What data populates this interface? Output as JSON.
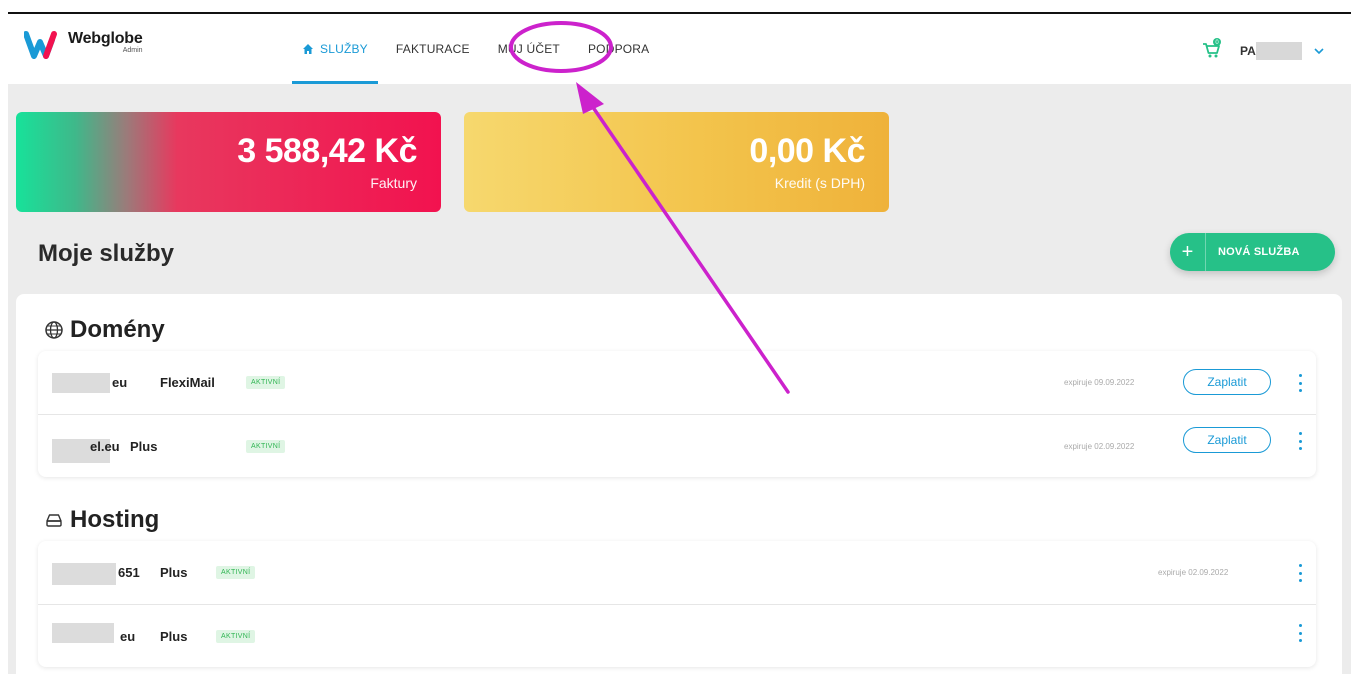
{
  "brand": {
    "name": "Webglobe",
    "sub": "Admin"
  },
  "nav": {
    "items": [
      {
        "label": "SLUŽBY",
        "active": true
      },
      {
        "label": "FAKTURACE",
        "active": false
      },
      {
        "label": "MŮJ ÚČET",
        "active": false
      },
      {
        "label": "PODPORA",
        "active": false
      }
    ]
  },
  "user": {
    "initials": "PA",
    "cart_count": "0"
  },
  "cards": {
    "invoices": {
      "amount": "3 588,42 Kč",
      "label": "Faktury"
    },
    "credit": {
      "amount": "0,00 Kč",
      "label": "Kredit (s DPH)"
    }
  },
  "page_title": "Moje služby",
  "new_service_label": "NOVÁ SLUŽBA",
  "domains": {
    "title": "Domény",
    "rows": [
      {
        "name": "eu",
        "plan": "FlexiMail",
        "status": "AKTIVNÍ",
        "expire": "expiruje 09.09.2022",
        "action": "Zaplatit"
      },
      {
        "name": "el.eu",
        "plan": "Plus",
        "status": "AKTIVNÍ",
        "expire": "expiruje 02.09.2022",
        "action": "Zaplatit"
      }
    ]
  },
  "hosting": {
    "title": "Hosting",
    "rows": [
      {
        "name": "651",
        "plan": "Plus",
        "status": "AKTIVNÍ",
        "expire": "expiruje 02.09.2022"
      },
      {
        "name": "eu",
        "plan": "Plus",
        "status": "AKTIVNÍ",
        "expire": ""
      }
    ]
  },
  "colors": {
    "accent": "#1a9ad6",
    "green": "#26c188",
    "red": "#f2124f",
    "yellow": "#f3c44c",
    "annotation": "#cc22cc"
  }
}
